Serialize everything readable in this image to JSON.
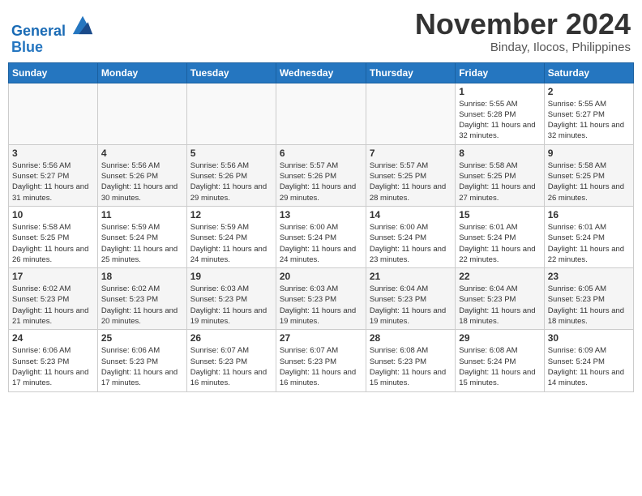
{
  "header": {
    "logo_line1": "General",
    "logo_line2": "Blue",
    "month": "November 2024",
    "location": "Binday, Ilocos, Philippines"
  },
  "weekdays": [
    "Sunday",
    "Monday",
    "Tuesday",
    "Wednesday",
    "Thursday",
    "Friday",
    "Saturday"
  ],
  "weeks": [
    [
      {
        "day": "",
        "info": ""
      },
      {
        "day": "",
        "info": ""
      },
      {
        "day": "",
        "info": ""
      },
      {
        "day": "",
        "info": ""
      },
      {
        "day": "",
        "info": ""
      },
      {
        "day": "1",
        "info": "Sunrise: 5:55 AM\nSunset: 5:28 PM\nDaylight: 11 hours and 32 minutes."
      },
      {
        "day": "2",
        "info": "Sunrise: 5:55 AM\nSunset: 5:27 PM\nDaylight: 11 hours and 32 minutes."
      }
    ],
    [
      {
        "day": "3",
        "info": "Sunrise: 5:56 AM\nSunset: 5:27 PM\nDaylight: 11 hours and 31 minutes."
      },
      {
        "day": "4",
        "info": "Sunrise: 5:56 AM\nSunset: 5:26 PM\nDaylight: 11 hours and 30 minutes."
      },
      {
        "day": "5",
        "info": "Sunrise: 5:56 AM\nSunset: 5:26 PM\nDaylight: 11 hours and 29 minutes."
      },
      {
        "day": "6",
        "info": "Sunrise: 5:57 AM\nSunset: 5:26 PM\nDaylight: 11 hours and 29 minutes."
      },
      {
        "day": "7",
        "info": "Sunrise: 5:57 AM\nSunset: 5:25 PM\nDaylight: 11 hours and 28 minutes."
      },
      {
        "day": "8",
        "info": "Sunrise: 5:58 AM\nSunset: 5:25 PM\nDaylight: 11 hours and 27 minutes."
      },
      {
        "day": "9",
        "info": "Sunrise: 5:58 AM\nSunset: 5:25 PM\nDaylight: 11 hours and 26 minutes."
      }
    ],
    [
      {
        "day": "10",
        "info": "Sunrise: 5:58 AM\nSunset: 5:25 PM\nDaylight: 11 hours and 26 minutes."
      },
      {
        "day": "11",
        "info": "Sunrise: 5:59 AM\nSunset: 5:24 PM\nDaylight: 11 hours and 25 minutes."
      },
      {
        "day": "12",
        "info": "Sunrise: 5:59 AM\nSunset: 5:24 PM\nDaylight: 11 hours and 24 minutes."
      },
      {
        "day": "13",
        "info": "Sunrise: 6:00 AM\nSunset: 5:24 PM\nDaylight: 11 hours and 24 minutes."
      },
      {
        "day": "14",
        "info": "Sunrise: 6:00 AM\nSunset: 5:24 PM\nDaylight: 11 hours and 23 minutes."
      },
      {
        "day": "15",
        "info": "Sunrise: 6:01 AM\nSunset: 5:24 PM\nDaylight: 11 hours and 22 minutes."
      },
      {
        "day": "16",
        "info": "Sunrise: 6:01 AM\nSunset: 5:24 PM\nDaylight: 11 hours and 22 minutes."
      }
    ],
    [
      {
        "day": "17",
        "info": "Sunrise: 6:02 AM\nSunset: 5:23 PM\nDaylight: 11 hours and 21 minutes."
      },
      {
        "day": "18",
        "info": "Sunrise: 6:02 AM\nSunset: 5:23 PM\nDaylight: 11 hours and 20 minutes."
      },
      {
        "day": "19",
        "info": "Sunrise: 6:03 AM\nSunset: 5:23 PM\nDaylight: 11 hours and 19 minutes."
      },
      {
        "day": "20",
        "info": "Sunrise: 6:03 AM\nSunset: 5:23 PM\nDaylight: 11 hours and 19 minutes."
      },
      {
        "day": "21",
        "info": "Sunrise: 6:04 AM\nSunset: 5:23 PM\nDaylight: 11 hours and 19 minutes."
      },
      {
        "day": "22",
        "info": "Sunrise: 6:04 AM\nSunset: 5:23 PM\nDaylight: 11 hours and 18 minutes."
      },
      {
        "day": "23",
        "info": "Sunrise: 6:05 AM\nSunset: 5:23 PM\nDaylight: 11 hours and 18 minutes."
      }
    ],
    [
      {
        "day": "24",
        "info": "Sunrise: 6:06 AM\nSunset: 5:23 PM\nDaylight: 11 hours and 17 minutes."
      },
      {
        "day": "25",
        "info": "Sunrise: 6:06 AM\nSunset: 5:23 PM\nDaylight: 11 hours and 17 minutes."
      },
      {
        "day": "26",
        "info": "Sunrise: 6:07 AM\nSunset: 5:23 PM\nDaylight: 11 hours and 16 minutes."
      },
      {
        "day": "27",
        "info": "Sunrise: 6:07 AM\nSunset: 5:23 PM\nDaylight: 11 hours and 16 minutes."
      },
      {
        "day": "28",
        "info": "Sunrise: 6:08 AM\nSunset: 5:23 PM\nDaylight: 11 hours and 15 minutes."
      },
      {
        "day": "29",
        "info": "Sunrise: 6:08 AM\nSunset: 5:24 PM\nDaylight: 11 hours and 15 minutes."
      },
      {
        "day": "30",
        "info": "Sunrise: 6:09 AM\nSunset: 5:24 PM\nDaylight: 11 hours and 14 minutes."
      }
    ]
  ]
}
